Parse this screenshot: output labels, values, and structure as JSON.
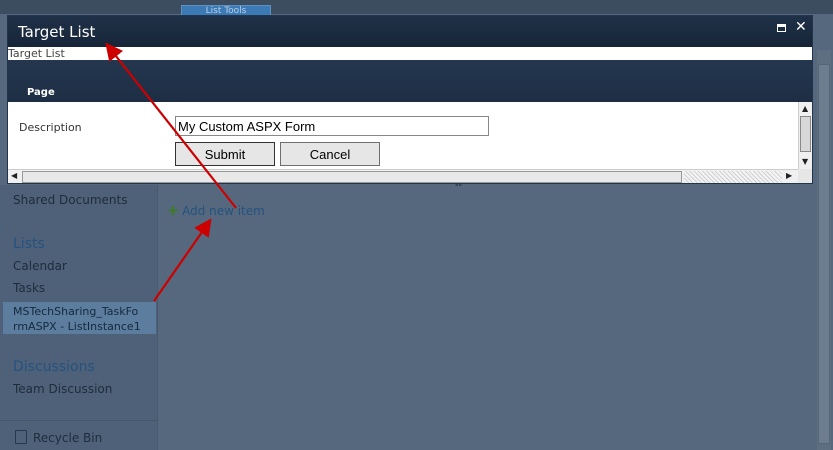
{
  "background": {
    "ribbon_tab": "List Tools",
    "left_nav": {
      "shared_documents": "Shared Documents",
      "lists_header": "Lists",
      "calendar": "Calendar",
      "tasks": "Tasks",
      "selected_item": "MSTechSharing_TaskFo\nrmASPX - ListInstance1",
      "discussions_header": "Discussions",
      "team_discussion": "Team Discussion",
      "recycle_bin": "Recycle Bin"
    },
    "add_new_item": "Add new item"
  },
  "dialog": {
    "title": "Target List",
    "breadcrumb": "Target List",
    "ribbon_tab": "Page",
    "form": {
      "description_label": "Description",
      "description_value": "My Custom ASPX Form",
      "submit_label": "Submit",
      "cancel_label": "Cancel"
    }
  },
  "colors": {
    "annotation_arrow": "#cc0000",
    "dialog_titlebar": "#1b2b40",
    "nav_header": "#25527f"
  }
}
